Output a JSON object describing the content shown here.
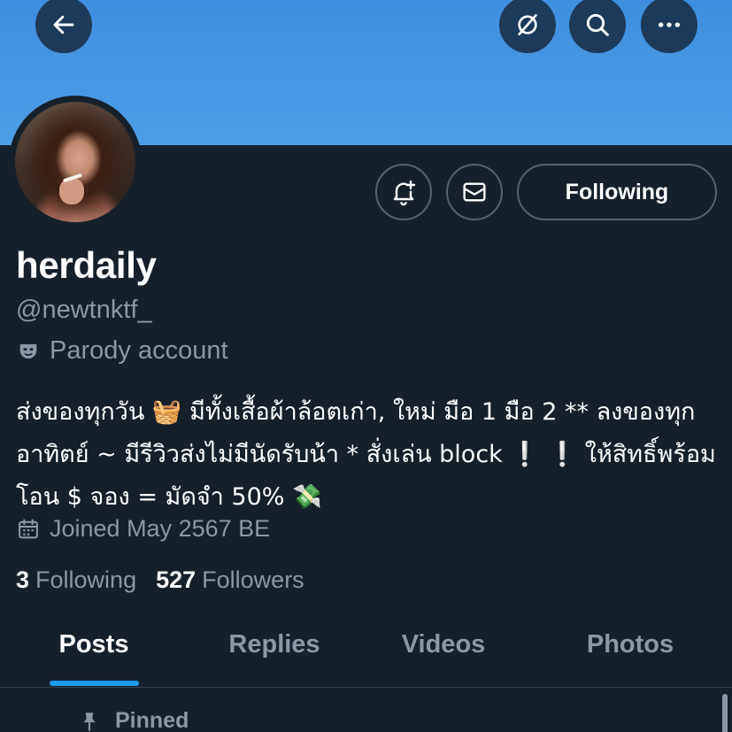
{
  "header": {
    "back_icon": "arrow-left-icon",
    "translate_icon": "translate-off-icon",
    "search_icon": "search-icon",
    "more_icon": "more-horizontal-icon",
    "banner_color": "#4c9ee6"
  },
  "profile": {
    "avatar_icon": "avatar-photo",
    "display_name": "herdaily",
    "handle": "@newtnktf_",
    "parody_label": "Parody account",
    "bio": "ส่งของทุกวัน 🧺 มีทั้งเสื้อผ้าล้อตเก่า, ใหม่ มือ 1 มือ 2 ** ลงของทุกอาทิตย์ ~ มีรีวิวส่งไม่มีนัดรับน้า * สั่งเล่น block ❕ ❕ ให้สิทธิ์พร้อมโอน $ จอง = มัดจำ 50% 💸",
    "joined": "Joined May 2567 BE",
    "following_count": "3",
    "following_label": "Following",
    "followers_count": "527",
    "followers_label": "Followers"
  },
  "actions": {
    "notify_icon": "bell-plus-icon",
    "message_icon": "envelope-icon",
    "following_button": "Following"
  },
  "tabs": [
    {
      "label": "Posts",
      "active": true
    },
    {
      "label": "Replies",
      "active": false
    },
    {
      "label": "Videos",
      "active": false
    },
    {
      "label": "Photos",
      "active": false
    }
  ],
  "pinned": {
    "label": "Pinned",
    "icon": "pin-icon"
  },
  "colors": {
    "background": "#15202b",
    "accent": "#1d9bf0",
    "muted_text": "#8b98a5",
    "border": "#536471"
  }
}
